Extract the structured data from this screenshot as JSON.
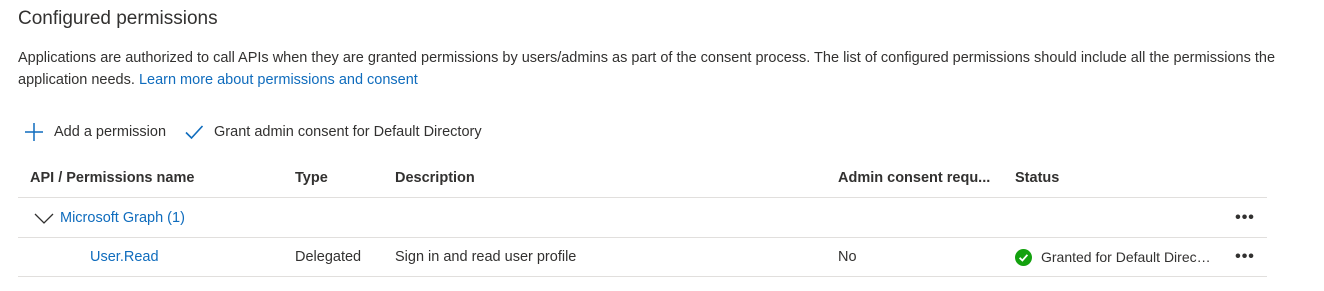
{
  "section": {
    "title": "Configured permissions",
    "description": "Applications are authorized to call APIs when they are granted permissions by users/admins as part of the consent process. The list of configured permissions should include all the permissions the application needs.",
    "learn_more_link": "Learn more about permissions and consent"
  },
  "toolbar": {
    "add_permission_label": "Add a permission",
    "grant_consent_label": "Grant admin consent for Default Directory"
  },
  "table": {
    "columns": {
      "name": "API / Permissions name",
      "type": "Type",
      "description": "Description",
      "admin_consent": "Admin consent requ...",
      "status": "Status"
    },
    "groups": [
      {
        "name": "Microsoft Graph (1)",
        "expanded": true,
        "permissions": [
          {
            "name": "User.Read",
            "type": "Delegated",
            "description": "Sign in and read user profile",
            "admin_consent": "No",
            "status": "Granted for Default Directory"
          }
        ]
      }
    ],
    "more_label": "..."
  },
  "icons": {
    "add": "plus-icon",
    "grant": "checkmark-icon",
    "group_toggle": "chevron-down-icon",
    "status": "success-check-circle-icon",
    "more": "more-options-icon"
  },
  "colors": {
    "accent": "#0f6cbd",
    "success": "#13a10e",
    "text": "#323130",
    "divider": "#e1dfdd"
  }
}
